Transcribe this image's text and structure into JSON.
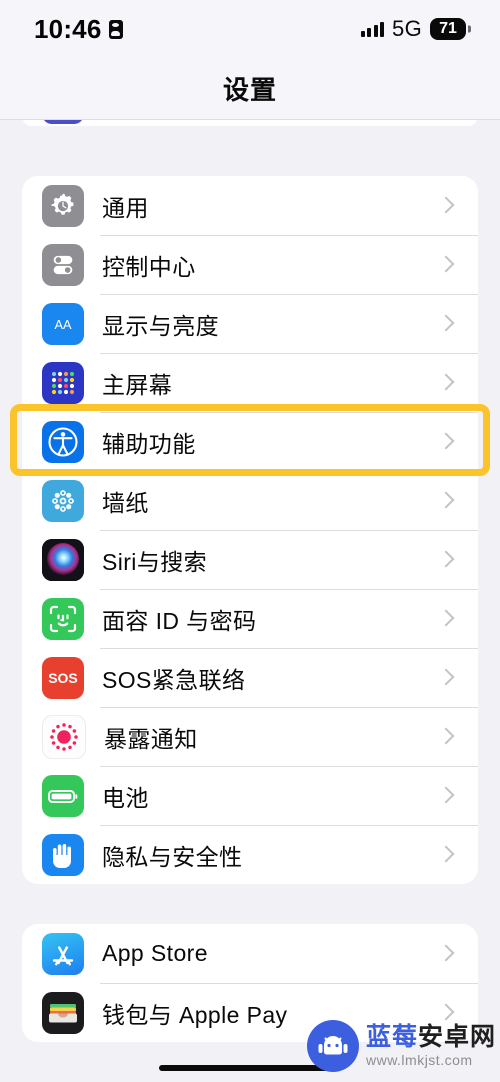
{
  "status_bar": {
    "time": "10:46",
    "lock_icon": "person-lock-icon",
    "signal_icon": "cellular-signal-icon",
    "network": "5G",
    "battery_level": "71"
  },
  "nav": {
    "title": "设置"
  },
  "groups": [
    {
      "id": "partial-top-card",
      "clipped": true,
      "rows": [
        {
          "icon": "focus-icon",
          "label": "",
          "chevron": true
        }
      ]
    },
    {
      "id": "system-card",
      "clipped": false,
      "rows": [
        {
          "icon": "gear-icon",
          "label": "通用",
          "chevron": true
        },
        {
          "icon": "control-center-icon",
          "label": "控制中心",
          "chevron": true
        },
        {
          "icon": "display-brightness-icon",
          "label": "显示与亮度",
          "chevron": true
        },
        {
          "icon": "home-screen-icon",
          "label": "主屏幕",
          "chevron": true
        },
        {
          "icon": "accessibility-icon",
          "label": "辅助功能",
          "chevron": true
        },
        {
          "icon": "wallpaper-icon",
          "label": "墙纸",
          "chevron": true
        },
        {
          "icon": "siri-icon",
          "label": "Siri与搜索",
          "chevron": true
        },
        {
          "icon": "face-id-icon",
          "label": "面容 ID 与密码",
          "chevron": true
        },
        {
          "icon": "sos-icon",
          "label": "SOS紧急联络",
          "chevron": true
        },
        {
          "icon": "exposure-notification-icon",
          "label": "暴露通知",
          "chevron": true
        },
        {
          "icon": "battery-icon",
          "label": "电池",
          "chevron": true
        },
        {
          "icon": "privacy-hand-icon",
          "label": "隐私与安全性",
          "chevron": true
        }
      ]
    },
    {
      "id": "store-card",
      "clipped": false,
      "rows": [
        {
          "icon": "app-store-icon",
          "label": "App Store",
          "chevron": true
        },
        {
          "icon": "wallet-icon",
          "label": "钱包与 Apple Pay",
          "chevron": true
        }
      ]
    }
  ],
  "highlight": {
    "target_label": "辅助功能",
    "color": "#fcc42b"
  },
  "watermark": {
    "brand_blue": "蓝莓",
    "brand_dark": "安卓网",
    "url": "www.lmkjst.com",
    "logo_icon": "android-robot-icon"
  },
  "colors": {
    "page_background": "#f2f1f6",
    "card_background": "#ffffff",
    "chevron": "#c3c3c6",
    "separator": "#dcdcde",
    "text_primary": "#0a0a0a"
  }
}
